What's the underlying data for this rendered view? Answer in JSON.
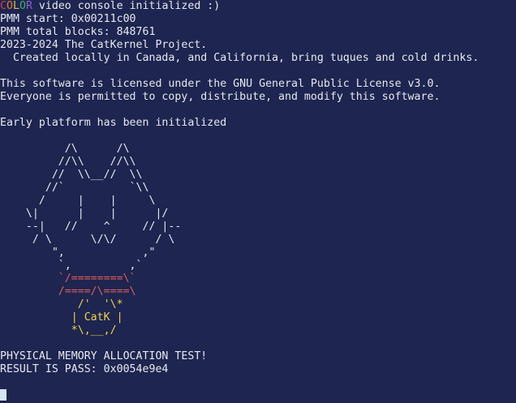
{
  "palette": {
    "background": "#1d2550",
    "text": "#e8e8f0",
    "cat_red": "#e05c5c",
    "cat_yellow": "#f0d24a",
    "cursor": "#d6e4f8",
    "color_c": "#d04040",
    "color_o1": "#e07a30",
    "color_l": "#d8c838",
    "color_o2": "#40b060",
    "color_r": "#9060d0"
  },
  "console": {
    "banner": {
      "letters": [
        "C",
        "O",
        "L",
        "O",
        "R"
      ],
      "rest": " video console initialized :)"
    },
    "pmm_start": "PMM start: 0x00211c00",
    "pmm_total_blocks": "PMM total blocks: 848761",
    "copyright": "2023-2024 The CatKernel Project.",
    "created": "  Created locally in Canada, and California, bring tuques and cold drinks.",
    "license": "This software is licensed under the GNU General Public License v3.0.",
    "permission": "Everyone is permitted to copy, distribute, and modify this software.",
    "platform": "Early platform has been initialized",
    "cat_art": {
      "ears_and_face": [
        "          /\\      /\\",
        "         //\\\\    //\\\\",
        "        //  \\\\__//  \\\\",
        "       //`          `\\\\",
        "      /     |    |     \\",
        "    \\|      |    |      |/",
        "    --|   //    ^     // |--",
        "     / \\      \\/\\/      / \\",
        "        \",            ,\"",
        "         `,         ,`"
      ],
      "red_lines": [
        "         `/========\\`",
        "         /====/\\====\\"
      ],
      "yellow_lines": [
        "            /'  '\\*",
        "           | CatK |",
        "           *\\,__,/"
      ]
    },
    "memory_test": "PHYSICAL MEMORY ALLOCATION TEST!",
    "result": "RESULT IS PASS: 0x0054e9e4"
  }
}
